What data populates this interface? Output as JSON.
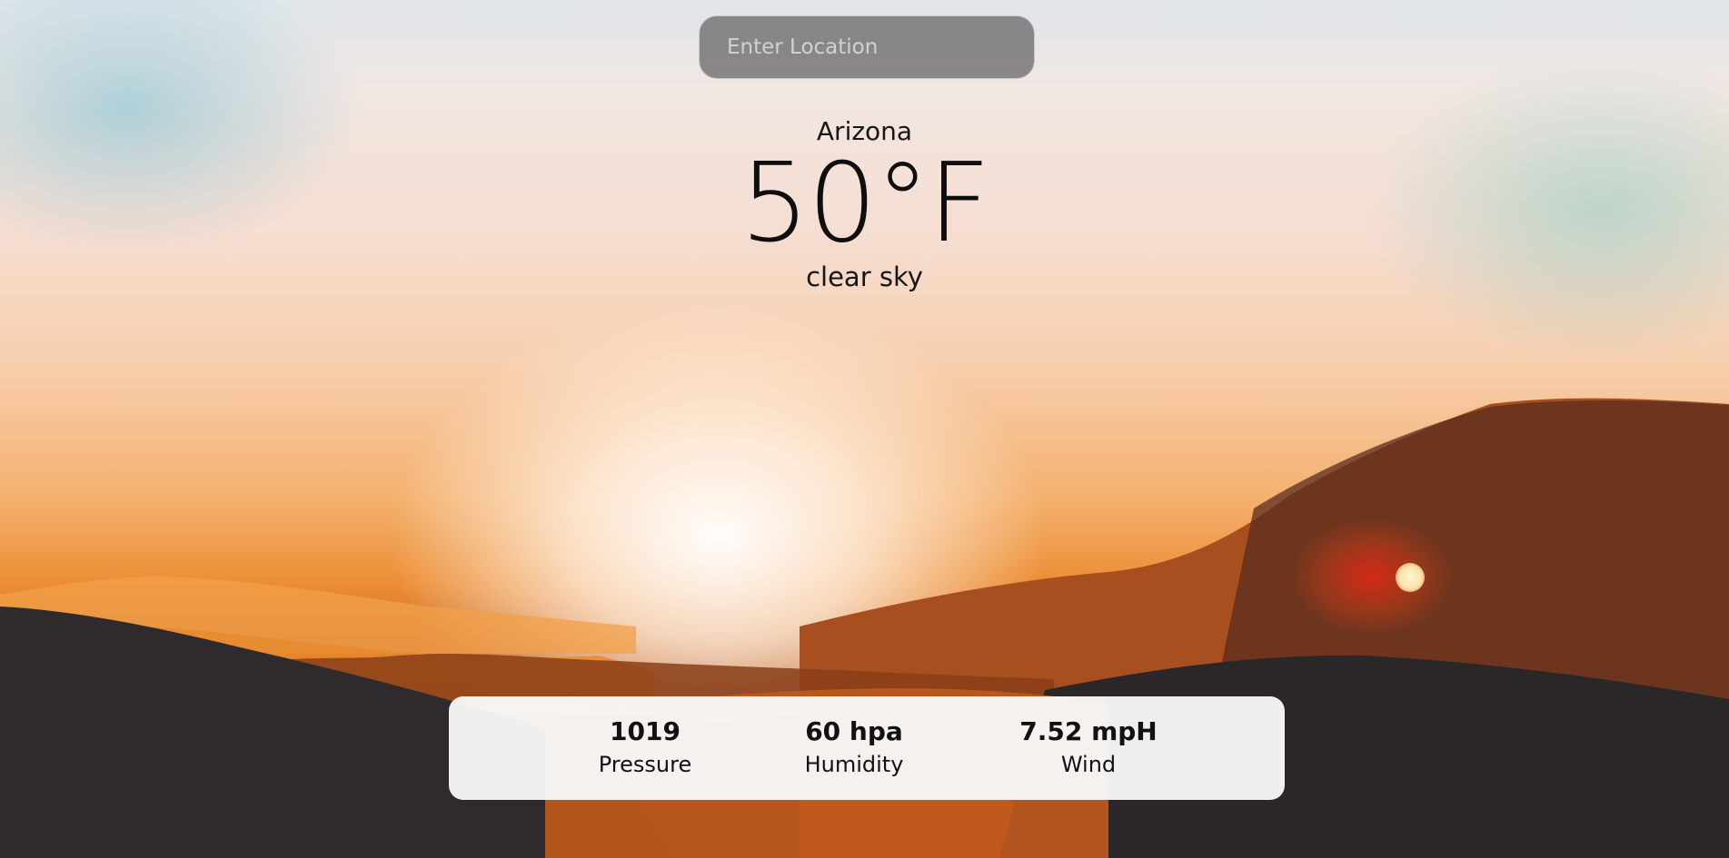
{
  "search": {
    "placeholder": "Enter Location",
    "value": ""
  },
  "weather": {
    "location": "Arizona",
    "temperature": "50°F",
    "description": "clear sky"
  },
  "stats": {
    "pressure": {
      "value": "1019",
      "label": "Pressure"
    },
    "humidity": {
      "value": "60 hpa",
      "label": "Humidity"
    },
    "wind": {
      "value": "7.52 mpH",
      "label": "Wind"
    }
  },
  "colors": {
    "sky_top": "#dfe6ea",
    "sunset_orange": "#ec8e35",
    "mountain_dark": "#3b2a25",
    "card_background": "#f8f8f8",
    "search_background": "#5a5a5a"
  }
}
